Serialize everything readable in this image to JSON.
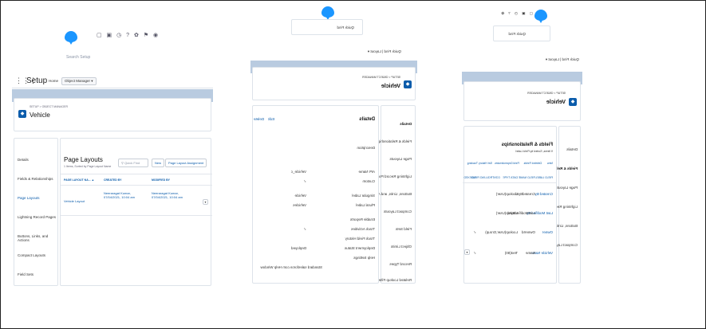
{
  "panel1": {
    "header_icons": "▢ ▣ ◷ ? ✿ ⚑ ◉",
    "search_placeholder": "Search Setup",
    "app_launcher_icon": "grid-icon",
    "setup_title": "Setup",
    "nav_home": "Home",
    "nav_object_manager": "Object Manager",
    "breadcrumb": "SETUP > OBJECT MANAGER",
    "object_name": "Vehicle",
    "sidebar": [
      "Details",
      "Fields & Relationships",
      "Page Layouts",
      "Lightning Record Pages",
      "Buttons, Links, and Actions",
      "Compact Layouts",
      "Field Sets"
    ],
    "sidebar_active_index": 2,
    "page_layouts_title": "Page Layouts",
    "page_layouts_subtitle": "1 Items, Sorted by Page Layout Name",
    "quick_find_placeholder": "Quick Find",
    "new_button": "New",
    "assignment_button": "Page Layout Assignment",
    "columns": [
      "PAGE LAYOUT NA... ▲",
      "CREATED BY",
      "MODIFIED BY"
    ],
    "rows": [
      {
        "name": "Vehicle Layout",
        "created": "Neeraragat Kumar, 07/04/2021, 10:04 am",
        "modified": "Neeraragat Kumar, 07/04/2021, 10:04 am"
      }
    ],
    "row_action_icon": "chevron-down-icon"
  },
  "panel2": {
    "quick_find": "Quick Find",
    "view_all_label": "Edit",
    "tabs_text": "Quick Find | Layout ▾",
    "breadcrumb": "SETUP > OBJECT MANAGER",
    "object_name": "Vehicle",
    "sidebar": [
      "Details",
      "Fields & Relationships",
      "Page Layouts",
      "Lightning Record Pages",
      "Buttons, Links, and Actions",
      "Compact Layouts",
      "Field Sets",
      "Object Limits",
      "Record Types",
      "Related Lookup Filters"
    ],
    "details_title": "Details",
    "edit_buttons": [
      "Edit",
      "Delete"
    ],
    "left_fields": [
      "Description",
      "API Name",
      "Custom",
      "Singular Label",
      "Plural Label",
      "Enable Reports",
      "Track Activities",
      "Track Field History",
      "Deployment Status",
      "Help Settings"
    ],
    "right_fields": [
      "Vehicle_c",
      "✓",
      "Vehicle",
      "Vehicles",
      "✓",
      "Deployed",
      "Standard salesforce.com Help Window"
    ]
  },
  "panel3": {
    "quick_find": "Quick Find",
    "tabs_text": "Quick Find | Layout ▾",
    "breadcrumb": "SETUP > OBJECT MANAGER",
    "object_name": "Vehicle",
    "sidebar": [
      "Details",
      "Fields & Relationships",
      "Page Layouts",
      "Lightning Record Pages",
      "Buttons, Links, and Actions",
      "Compact Layouts"
    ],
    "fields_title": "Fields & Relationships",
    "fields_subtitle": "9 Items, Sorted by Field Label",
    "toolbar": [
      "New",
      "Deleted Fields",
      "Field Dependencies",
      "Set History Tracking"
    ],
    "columns": [
      "FIELD LABEL",
      "FIELD NAME",
      "DATA TYPE",
      "CONTROLLING FIELD",
      "INDEXED"
    ],
    "rows": [
      [
        "Created By",
        "CreatedById",
        "Lookup(User)",
        "",
        ""
      ],
      [
        "Last Modified By",
        "LastModifiedById",
        "Lookup(User)",
        "",
        ""
      ],
      [
        "Owner",
        "OwnerId",
        "Lookup(User,Group)",
        "",
        "✓"
      ],
      [
        "Vehicle Name",
        "Name",
        "Text(80)",
        "",
        "✓"
      ]
    ]
  },
  "colors": {
    "accent": "#0b5cab",
    "brand_blue": "#1b96ff",
    "band": "#b9cbe0"
  }
}
